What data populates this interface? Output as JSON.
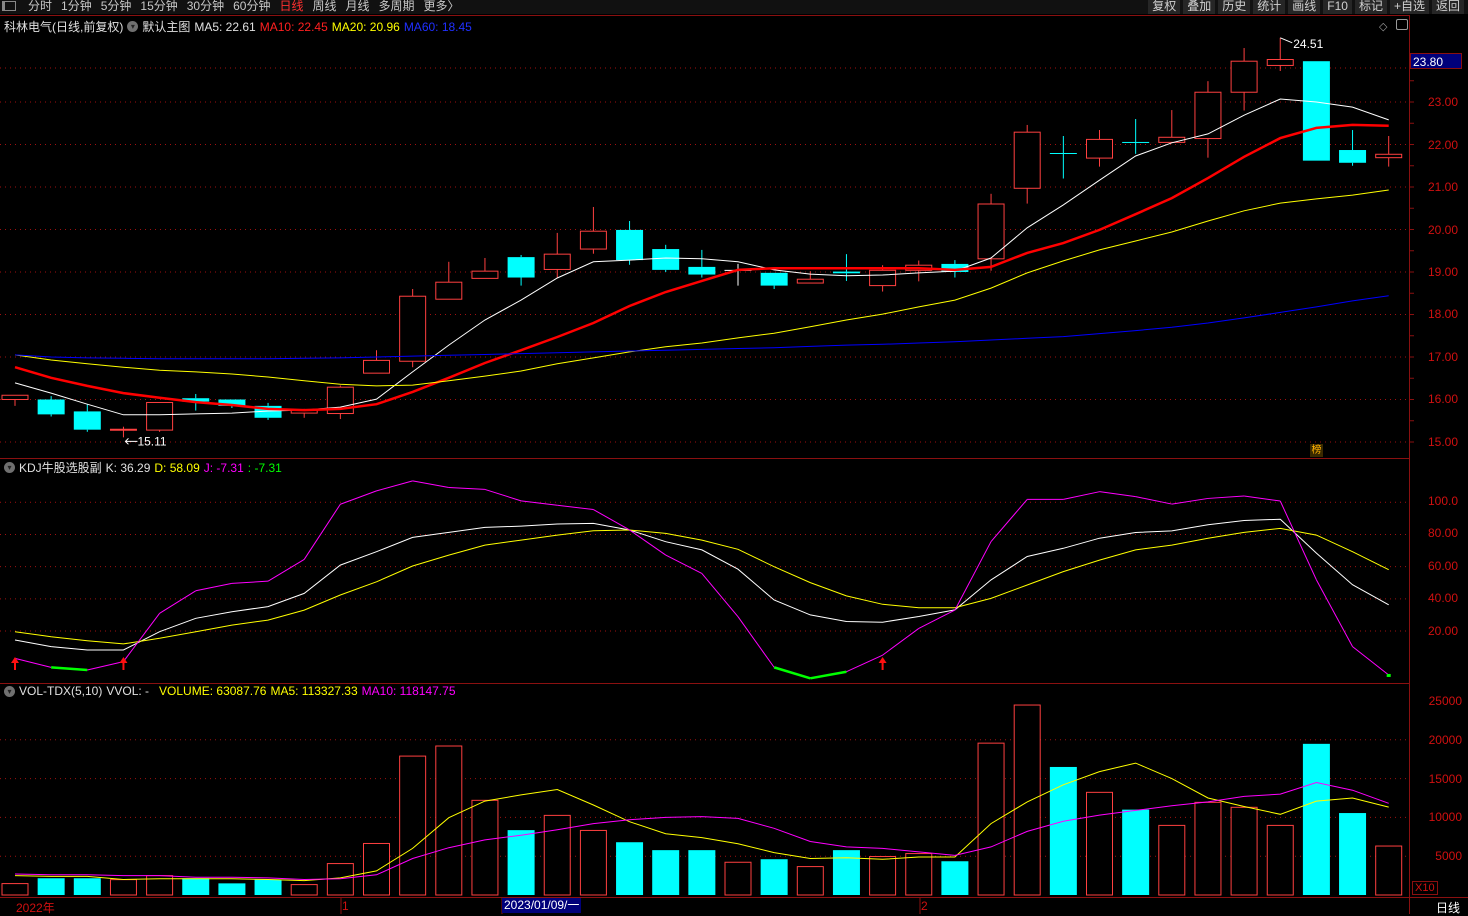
{
  "topbar": {
    "tabs": [
      "分时",
      "1分钟",
      "5分钟",
      "15分钟",
      "30分钟",
      "60分钟",
      "日线",
      "周线",
      "月线",
      "多周期",
      "更多〉"
    ],
    "active_tab": "日线",
    "buttons": [
      "复权",
      "叠加",
      "历史",
      "统计",
      "画线",
      "F10",
      "标记",
      "+自选",
      "返回"
    ]
  },
  "main": {
    "stock": "科林电气(日线,前复权)",
    "template": "默认主图",
    "ma5": "MA5: 22.61",
    "ma10": "MA10: 22.45",
    "ma20": "MA20: 20.96",
    "ma60": "MA60: 18.45",
    "current_price": "23.80",
    "high_label": "24.51",
    "low_label": "15.11",
    "badge": "榜",
    "axis_labels": [
      "23.00",
      "22.00",
      "21.00",
      "20.00",
      "19.00",
      "18.00",
      "17.00",
      "16.00",
      "15.00"
    ]
  },
  "kdj": {
    "title": "KDJ牛股选股副",
    "k": "K: 36.29",
    "d": "D: 58.09",
    "j": "J: -7.31",
    "extra": ": -7.31",
    "axis_labels": [
      "100.0",
      "80.00",
      "60.00",
      "40.00",
      "20.00"
    ]
  },
  "vol": {
    "title": "VOL-TDX(5,10)",
    "vvol": "VVOL: -",
    "volume": "VOLUME: 63087.76",
    "ma5": "MA5: 113327.33",
    "ma10": "MA10: 118147.75",
    "axis_labels": [
      "25000",
      "20000",
      "15000",
      "10000",
      "5000"
    ],
    "multiplier": "X10"
  },
  "xaxis": {
    "year": "2022年",
    "m1": "1",
    "selected_date": "2023/01/09/一",
    "m2": "2",
    "period": "日线"
  },
  "colors": {
    "up": "#ff4040",
    "down": "#00ffff",
    "ma5": "#ffffff",
    "ma10": "#ff0000",
    "ma20": "#ffff00",
    "ma60": "#0000ff",
    "grid": "#a01010"
  },
  "chart_data": [
    {
      "type": "candlestick",
      "title": "科林电气 日线 前复权",
      "ylim": [
        14.8,
        24.8
      ],
      "yticks": [
        15,
        16,
        17,
        18,
        19,
        20,
        21,
        22,
        23
      ],
      "ohlc": [
        [
          16.0,
          16.1,
          15.85,
          16.1
        ],
        [
          16.0,
          16.08,
          15.6,
          15.65
        ],
        [
          15.72,
          15.89,
          15.24,
          15.29
        ],
        [
          15.28,
          15.36,
          15.11,
          15.3
        ],
        [
          15.28,
          15.93,
          15.24,
          15.93
        ],
        [
          16.03,
          16.13,
          15.74,
          15.95
        ],
        [
          16.0,
          16.0,
          15.8,
          15.85
        ],
        [
          15.85,
          15.92,
          15.52,
          15.57
        ],
        [
          15.68,
          15.78,
          15.57,
          15.75
        ],
        [
          15.67,
          16.33,
          15.54,
          16.29
        ],
        [
          16.62,
          17.16,
          16.62,
          16.92
        ],
        [
          16.9,
          18.6,
          16.76,
          18.43
        ],
        [
          18.36,
          19.24,
          18.36,
          18.76
        ],
        [
          18.85,
          19.33,
          18.85,
          19.02
        ],
        [
          19.35,
          19.4,
          18.68,
          18.87
        ],
        [
          19.06,
          19.92,
          18.86,
          19.42
        ],
        [
          19.54,
          20.53,
          19.43,
          19.96
        ],
        [
          19.99,
          20.2,
          19.17,
          19.28
        ],
        [
          19.54,
          19.64,
          19.0,
          19.05
        ],
        [
          19.12,
          19.52,
          18.87,
          18.94
        ],
        [
          19.05,
          19.19,
          18.68,
          19.05
        ],
        [
          18.98,
          18.98,
          18.6,
          18.68
        ],
        [
          18.74,
          19.02,
          18.74,
          18.83
        ],
        [
          19.01,
          19.42,
          18.79,
          18.97
        ],
        [
          18.68,
          19.16,
          18.54,
          19.04
        ],
        [
          19.04,
          19.27,
          18.78,
          19.16
        ],
        [
          19.19,
          19.28,
          18.87,
          19.0
        ],
        [
          19.31,
          20.84,
          19.03,
          20.6
        ],
        [
          20.97,
          22.46,
          20.61,
          22.29
        ],
        [
          21.8,
          22.2,
          21.2,
          21.78
        ],
        [
          21.68,
          22.34,
          21.48,
          22.12
        ],
        [
          22.06,
          22.6,
          21.78,
          22.05
        ],
        [
          22.05,
          22.81,
          22.05,
          22.17
        ],
        [
          22.14,
          23.49,
          21.69,
          23.23
        ],
        [
          23.23,
          24.27,
          22.8,
          23.96
        ],
        [
          23.86,
          24.51,
          23.73,
          24.0
        ],
        [
          23.96,
          23.96,
          21.62,
          21.62
        ],
        [
          21.87,
          22.34,
          21.5,
          21.57
        ],
        [
          21.69,
          22.2,
          21.48,
          21.77
        ]
      ],
      "series": [
        {
          "name": "MA5",
          "values": [
            16.39,
            16.15,
            15.89,
            15.64,
            15.64,
            15.66,
            15.68,
            15.73,
            15.75,
            15.82,
            16.01,
            16.65,
            17.28,
            17.87,
            18.34,
            18.86,
            19.24,
            19.28,
            19.33,
            19.31,
            19.24,
            19.05,
            18.95,
            18.91,
            18.93,
            18.98,
            19.02,
            19.33,
            20.04,
            20.58,
            21.16,
            21.73,
            22.04,
            22.25,
            22.69,
            23.07,
            23.0,
            22.88,
            22.58
          ]
        },
        {
          "name": "MA10",
          "values": [
            16.76,
            16.51,
            16.32,
            16.15,
            16.04,
            15.94,
            15.87,
            15.78,
            15.75,
            15.78,
            15.89,
            16.18,
            16.51,
            16.86,
            17.16,
            17.47,
            17.8,
            18.2,
            18.53,
            18.79,
            19.05,
            19.09,
            19.09,
            19.09,
            19.09,
            19.09,
            19.05,
            19.12,
            19.45,
            19.68,
            19.99,
            20.36,
            20.74,
            21.21,
            21.71,
            22.15,
            22.39,
            22.46,
            22.44
          ]
        },
        {
          "name": "MA20",
          "values": [
            17.05,
            16.93,
            16.84,
            16.76,
            16.69,
            16.65,
            16.6,
            16.53,
            16.44,
            16.36,
            16.32,
            16.34,
            16.44,
            16.55,
            16.67,
            16.84,
            16.98,
            17.12,
            17.24,
            17.33,
            17.45,
            17.56,
            17.71,
            17.87,
            18.01,
            18.18,
            18.34,
            18.62,
            18.98,
            19.26,
            19.52,
            19.73,
            19.94,
            20.2,
            20.44,
            20.62,
            20.72,
            20.81,
            20.93
          ]
        },
        {
          "name": "MA60",
          "values": [
            17.05,
            17.0,
            16.98,
            16.97,
            16.96,
            16.96,
            16.96,
            16.96,
            16.97,
            16.98,
            17.0,
            17.02,
            17.04,
            17.06,
            17.08,
            17.1,
            17.12,
            17.14,
            17.16,
            17.18,
            17.2,
            17.22,
            17.25,
            17.28,
            17.3,
            17.33,
            17.36,
            17.4,
            17.44,
            17.48,
            17.55,
            17.62,
            17.7,
            17.8,
            17.92,
            18.05,
            18.18,
            18.32,
            18.44
          ]
        }
      ],
      "annotations": [
        {
          "label": "24.51",
          "index": 35,
          "kind": "high"
        },
        {
          "label": "15.11",
          "index": 3,
          "kind": "low"
        }
      ]
    },
    {
      "type": "line",
      "title": "KDJ牛股选股副",
      "ylim": [
        0,
        110
      ],
      "yticks": [
        20,
        40,
        60,
        80,
        100
      ],
      "series": [
        {
          "name": "K",
          "values": [
            14.4,
            10.3,
            8.2,
            8.2,
            19.6,
            27.9,
            32.0,
            35.2,
            43.4,
            61.0,
            69.3,
            78.2,
            81.3,
            84.4,
            85.2,
            86.5,
            86.9,
            82.8,
            75.5,
            70.4,
            58.4,
            39.3,
            30.0,
            25.9,
            25.5,
            29.0,
            33.1,
            51.8,
            66.3,
            71.4,
            77.7,
            81.2,
            82.2,
            86.0,
            88.7,
            89.5,
            68.4,
            48.8,
            36.29
          ]
        },
        {
          "name": "D",
          "values": [
            19.6,
            16.5,
            14.0,
            12.0,
            15.5,
            19.6,
            23.7,
            26.8,
            33.0,
            42.4,
            50.6,
            60.4,
            67.2,
            73.4,
            76.5,
            79.6,
            82.3,
            82.8,
            80.7,
            76.5,
            70.8,
            60.0,
            50.1,
            41.8,
            36.6,
            34.5,
            34.5,
            40.3,
            48.6,
            56.9,
            64.1,
            70.4,
            73.4,
            77.6,
            81.3,
            83.8,
            79.6,
            69.3,
            58.09
          ]
        },
        {
          "name": "J",
          "values": [
            3.0,
            -2.6,
            -4.2,
            1.0,
            31.0,
            45.0,
            49.6,
            51.0,
            64.5,
            98.8,
            107.1,
            113.3,
            109.2,
            108.0,
            100.9,
            98.2,
            95.5,
            82.8,
            67.2,
            55.8,
            28.9,
            -2.6,
            -9.4,
            -5.3,
            5.0,
            21.6,
            33.0,
            75.6,
            101.8,
            101.8,
            106.6,
            103.5,
            98.9,
            102.4,
            103.9,
            100.8,
            51.8,
            10.3,
            -7.31
          ]
        }
      ],
      "buy_signals": [
        0,
        3,
        24
      ]
    },
    {
      "type": "bar",
      "title": "VOL-TDX(5,10)",
      "ylim": [
        0,
        25000
      ],
      "yticks": [
        5000,
        10000,
        15000,
        20000,
        25000
      ],
      "values": [
        1470,
        2160,
        2160,
        1980,
        2500,
        2160,
        1500,
        1980,
        1340,
        4050,
        6640,
        17900,
        19200,
        12200,
        8360,
        10260,
        8320,
        6800,
        5780,
        5780,
        4220,
        4610,
        3660,
        5780,
        4960,
        5340,
        4350,
        19570,
        24480,
        16500,
        13230,
        11000,
        8970,
        11940,
        11300,
        8970,
        19480,
        10560,
        6309
      ],
      "series": [
        {
          "name": "MA5",
          "values": [
            2500,
            2400,
            2400,
            2000,
            2100,
            2100,
            2100,
            2000,
            1850,
            2200,
            3100,
            6000,
            9960,
            12100,
            12900,
            13600,
            11600,
            9440,
            7900,
            7400,
            6600,
            5470,
            4700,
            4800,
            4600,
            4900,
            4900,
            9200,
            12000,
            14200,
            15900,
            17000,
            15000,
            12500,
            11400,
            10400,
            12100,
            12500,
            11333
          ]
        },
        {
          "name": "MA10",
          "values": [
            2700,
            2600,
            2600,
            2500,
            2500,
            2300,
            2300,
            2200,
            2000,
            2100,
            2600,
            4700,
            6100,
            7100,
            7700,
            8400,
            9200,
            9700,
            10000,
            10100,
            9870,
            8600,
            6900,
            6200,
            6000,
            5560,
            5100,
            6200,
            8200,
            9500,
            10300,
            10900,
            11500,
            12000,
            12700,
            13000,
            14500,
            13500,
            11815
          ]
        }
      ]
    }
  ]
}
